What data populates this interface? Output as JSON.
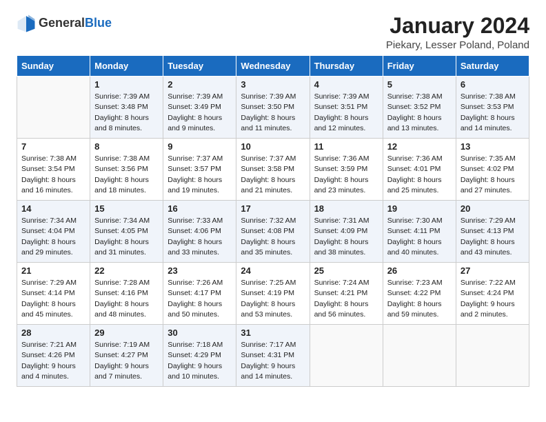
{
  "logo": {
    "general": "General",
    "blue": "Blue"
  },
  "title": "January 2024",
  "location": "Piekary, Lesser Poland, Poland",
  "weekdays": [
    "Sunday",
    "Monday",
    "Tuesday",
    "Wednesday",
    "Thursday",
    "Friday",
    "Saturday"
  ],
  "weeks": [
    [
      {
        "day": null,
        "sunrise": null,
        "sunset": null,
        "daylight": null
      },
      {
        "day": "1",
        "sunrise": "Sunrise: 7:39 AM",
        "sunset": "Sunset: 3:48 PM",
        "daylight": "Daylight: 8 hours and 8 minutes."
      },
      {
        "day": "2",
        "sunrise": "Sunrise: 7:39 AM",
        "sunset": "Sunset: 3:49 PM",
        "daylight": "Daylight: 8 hours and 9 minutes."
      },
      {
        "day": "3",
        "sunrise": "Sunrise: 7:39 AM",
        "sunset": "Sunset: 3:50 PM",
        "daylight": "Daylight: 8 hours and 11 minutes."
      },
      {
        "day": "4",
        "sunrise": "Sunrise: 7:39 AM",
        "sunset": "Sunset: 3:51 PM",
        "daylight": "Daylight: 8 hours and 12 minutes."
      },
      {
        "day": "5",
        "sunrise": "Sunrise: 7:38 AM",
        "sunset": "Sunset: 3:52 PM",
        "daylight": "Daylight: 8 hours and 13 minutes."
      },
      {
        "day": "6",
        "sunrise": "Sunrise: 7:38 AM",
        "sunset": "Sunset: 3:53 PM",
        "daylight": "Daylight: 8 hours and 14 minutes."
      }
    ],
    [
      {
        "day": "7",
        "sunrise": "Sunrise: 7:38 AM",
        "sunset": "Sunset: 3:54 PM",
        "daylight": "Daylight: 8 hours and 16 minutes."
      },
      {
        "day": "8",
        "sunrise": "Sunrise: 7:38 AM",
        "sunset": "Sunset: 3:56 PM",
        "daylight": "Daylight: 8 hours and 18 minutes."
      },
      {
        "day": "9",
        "sunrise": "Sunrise: 7:37 AM",
        "sunset": "Sunset: 3:57 PM",
        "daylight": "Daylight: 8 hours and 19 minutes."
      },
      {
        "day": "10",
        "sunrise": "Sunrise: 7:37 AM",
        "sunset": "Sunset: 3:58 PM",
        "daylight": "Daylight: 8 hours and 21 minutes."
      },
      {
        "day": "11",
        "sunrise": "Sunrise: 7:36 AM",
        "sunset": "Sunset: 3:59 PM",
        "daylight": "Daylight: 8 hours and 23 minutes."
      },
      {
        "day": "12",
        "sunrise": "Sunrise: 7:36 AM",
        "sunset": "Sunset: 4:01 PM",
        "daylight": "Daylight: 8 hours and 25 minutes."
      },
      {
        "day": "13",
        "sunrise": "Sunrise: 7:35 AM",
        "sunset": "Sunset: 4:02 PM",
        "daylight": "Daylight: 8 hours and 27 minutes."
      }
    ],
    [
      {
        "day": "14",
        "sunrise": "Sunrise: 7:34 AM",
        "sunset": "Sunset: 4:04 PM",
        "daylight": "Daylight: 8 hours and 29 minutes."
      },
      {
        "day": "15",
        "sunrise": "Sunrise: 7:34 AM",
        "sunset": "Sunset: 4:05 PM",
        "daylight": "Daylight: 8 hours and 31 minutes."
      },
      {
        "day": "16",
        "sunrise": "Sunrise: 7:33 AM",
        "sunset": "Sunset: 4:06 PM",
        "daylight": "Daylight: 8 hours and 33 minutes."
      },
      {
        "day": "17",
        "sunrise": "Sunrise: 7:32 AM",
        "sunset": "Sunset: 4:08 PM",
        "daylight": "Daylight: 8 hours and 35 minutes."
      },
      {
        "day": "18",
        "sunrise": "Sunrise: 7:31 AM",
        "sunset": "Sunset: 4:09 PM",
        "daylight": "Daylight: 8 hours and 38 minutes."
      },
      {
        "day": "19",
        "sunrise": "Sunrise: 7:30 AM",
        "sunset": "Sunset: 4:11 PM",
        "daylight": "Daylight: 8 hours and 40 minutes."
      },
      {
        "day": "20",
        "sunrise": "Sunrise: 7:29 AM",
        "sunset": "Sunset: 4:13 PM",
        "daylight": "Daylight: 8 hours and 43 minutes."
      }
    ],
    [
      {
        "day": "21",
        "sunrise": "Sunrise: 7:29 AM",
        "sunset": "Sunset: 4:14 PM",
        "daylight": "Daylight: 8 hours and 45 minutes."
      },
      {
        "day": "22",
        "sunrise": "Sunrise: 7:28 AM",
        "sunset": "Sunset: 4:16 PM",
        "daylight": "Daylight: 8 hours and 48 minutes."
      },
      {
        "day": "23",
        "sunrise": "Sunrise: 7:26 AM",
        "sunset": "Sunset: 4:17 PM",
        "daylight": "Daylight: 8 hours and 50 minutes."
      },
      {
        "day": "24",
        "sunrise": "Sunrise: 7:25 AM",
        "sunset": "Sunset: 4:19 PM",
        "daylight": "Daylight: 8 hours and 53 minutes."
      },
      {
        "day": "25",
        "sunrise": "Sunrise: 7:24 AM",
        "sunset": "Sunset: 4:21 PM",
        "daylight": "Daylight: 8 hours and 56 minutes."
      },
      {
        "day": "26",
        "sunrise": "Sunrise: 7:23 AM",
        "sunset": "Sunset: 4:22 PM",
        "daylight": "Daylight: 8 hours and 59 minutes."
      },
      {
        "day": "27",
        "sunrise": "Sunrise: 7:22 AM",
        "sunset": "Sunset: 4:24 PM",
        "daylight": "Daylight: 9 hours and 2 minutes."
      }
    ],
    [
      {
        "day": "28",
        "sunrise": "Sunrise: 7:21 AM",
        "sunset": "Sunset: 4:26 PM",
        "daylight": "Daylight: 9 hours and 4 minutes."
      },
      {
        "day": "29",
        "sunrise": "Sunrise: 7:19 AM",
        "sunset": "Sunset: 4:27 PM",
        "daylight": "Daylight: 9 hours and 7 minutes."
      },
      {
        "day": "30",
        "sunrise": "Sunrise: 7:18 AM",
        "sunset": "Sunset: 4:29 PM",
        "daylight": "Daylight: 9 hours and 10 minutes."
      },
      {
        "day": "31",
        "sunrise": "Sunrise: 7:17 AM",
        "sunset": "Sunset: 4:31 PM",
        "daylight": "Daylight: 9 hours and 14 minutes."
      },
      {
        "day": null,
        "sunrise": null,
        "sunset": null,
        "daylight": null
      },
      {
        "day": null,
        "sunrise": null,
        "sunset": null,
        "daylight": null
      },
      {
        "day": null,
        "sunrise": null,
        "sunset": null,
        "daylight": null
      }
    ]
  ]
}
